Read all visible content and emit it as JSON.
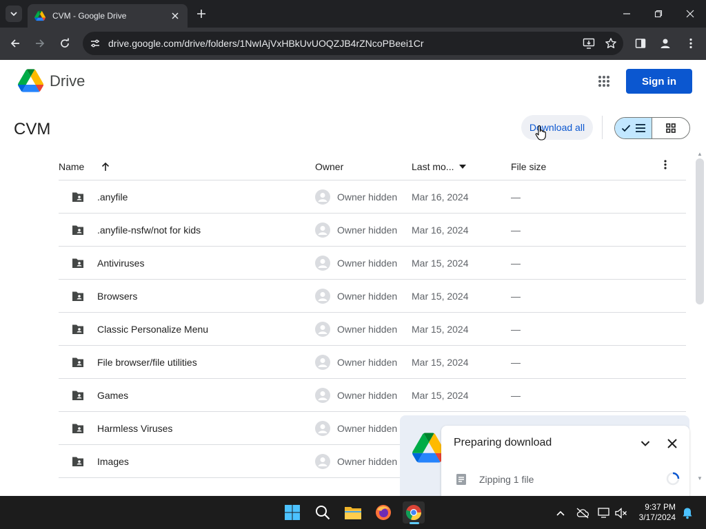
{
  "browser": {
    "tab_title": "CVM - Google Drive",
    "url": "drive.google.com/drive/folders/1NwIAjVxHBkUvUOQZJB4rZNcoPBeei1Cr"
  },
  "header": {
    "app_name": "Drive",
    "sign_in_label": "Sign in"
  },
  "folder": {
    "title": "CVM",
    "download_all_label": "Download all"
  },
  "table": {
    "columns": {
      "name": "Name",
      "owner": "Owner",
      "last_modified": "Last mo...",
      "file_size": "File size"
    },
    "rows": [
      {
        "name": ".anyfile",
        "owner": "Owner hidden",
        "modified": "Mar 16, 2024",
        "size": "—"
      },
      {
        "name": ".anyfile-nsfw/not for kids",
        "owner": "Owner hidden",
        "modified": "Mar 16, 2024",
        "size": "—"
      },
      {
        "name": "Antiviruses",
        "owner": "Owner hidden",
        "modified": "Mar 15, 2024",
        "size": "—"
      },
      {
        "name": "Browsers",
        "owner": "Owner hidden",
        "modified": "Mar 15, 2024",
        "size": "—"
      },
      {
        "name": "Classic Personalize Menu",
        "owner": "Owner hidden",
        "modified": "Mar 15, 2024",
        "size": "—"
      },
      {
        "name": "File browser/file utilities",
        "owner": "Owner hidden",
        "modified": "Mar 15, 2024",
        "size": "—"
      },
      {
        "name": "Games",
        "owner": "Owner hidden",
        "modified": "Mar 15, 2024",
        "size": "—"
      },
      {
        "name": "Harmless Viruses",
        "owner": "Owner hidden",
        "modified": "",
        "size": ""
      },
      {
        "name": "Images",
        "owner": "Owner hidden",
        "modified": "",
        "size": ""
      }
    ]
  },
  "download_toast": {
    "title": "Preparing download",
    "item_label": "Zipping 1 file"
  },
  "taskbar": {
    "time": "9:37 PM",
    "date": "3/17/2024"
  },
  "colors": {
    "accent": "#0b57d0",
    "selected_view": "#c2e7ff",
    "chrome_dark": "#202124",
    "taskbar": "#1c1c1c"
  }
}
